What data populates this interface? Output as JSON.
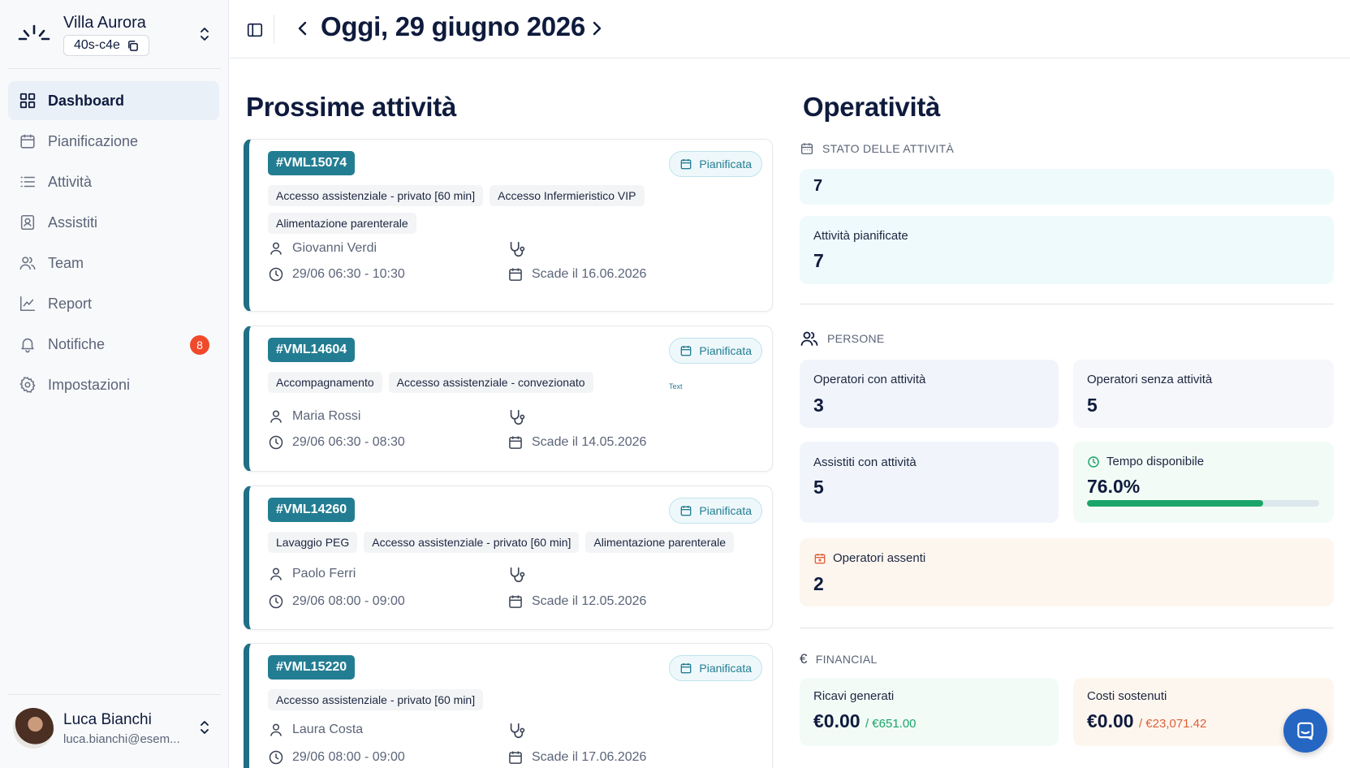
{
  "org": {
    "name": "Villa Aurora",
    "code": "40s-c4e"
  },
  "nav": {
    "items": [
      {
        "label": "Dashboard",
        "icon": "grid-icon",
        "active": true
      },
      {
        "label": "Pianificazione",
        "icon": "calendar-icon"
      },
      {
        "label": "Attività",
        "icon": "list-icon"
      },
      {
        "label": "Assistiti",
        "icon": "contact-icon"
      },
      {
        "label": "Team",
        "icon": "users-icon"
      },
      {
        "label": "Report",
        "icon": "chart-icon"
      },
      {
        "label": "Notifiche",
        "icon": "bell-icon",
        "badge": "8"
      },
      {
        "label": "Impostazioni",
        "icon": "gear-icon"
      }
    ]
  },
  "user": {
    "name": "Luca Bianchi",
    "email": "luca.bianchi@esem..."
  },
  "header": {
    "title": "Oggi, 29 giugno 2026"
  },
  "activities": {
    "title": "Prossime attività",
    "cards": [
      {
        "code": "#VML15074",
        "status": "Pianificata",
        "tags": [
          "Accesso assistenziale - privato [60 min]",
          "Accesso Infermieristico VIP",
          "Alimentazione parenterale"
        ],
        "person": "Giovanni Verdi",
        "time": "29/06 06:30 - 10:30",
        "due": "Scade il 16.06.2026"
      },
      {
        "code": "#VML14604",
        "status": "Pianificata",
        "tags": [
          "Accompagnamento",
          "Accesso assistenziale - convezionato"
        ],
        "extra": "Text",
        "person": "Maria Rossi",
        "time": "29/06 06:30 - 08:30",
        "due": "Scade il 14.05.2026"
      },
      {
        "code": "#VML14260",
        "status": "Pianificata",
        "tags": [
          "Lavaggio PEG",
          "Accesso assistenziale - privato [60 min]",
          "Alimentazione parenterale"
        ],
        "person": "Paolo Ferri",
        "time": "29/06 08:00 - 09:00",
        "due": "Scade il 12.05.2026"
      },
      {
        "code": "#VML15220",
        "status": "Pianificata",
        "tags": [
          "Accesso assistenziale - privato [60 min]"
        ],
        "person": "Laura Costa",
        "time": "29/06 08:00 - 09:00",
        "due": "Scade il 17.06.2026"
      }
    ]
  },
  "ops": {
    "title": "Operatività",
    "status": {
      "label": "STATO DELLE ATTIVITÀ",
      "total": "7",
      "planned_label": "Attività pianificate",
      "planned_value": "7"
    },
    "people": {
      "label": "PERSONE",
      "with_label": "Operatori con attività",
      "with_value": "3",
      "without_label": "Operatori senza attività",
      "without_value": "5",
      "assisted_label": "Assistiti con attività",
      "assisted_value": "5",
      "time_label": "Tempo disponibile",
      "time_value": "76.0%",
      "time_percent": 76,
      "absent_label": "Operatori assenti",
      "absent_value": "2"
    },
    "financial": {
      "label": "FINANCIAL",
      "revenue_label": "Ricavi generati",
      "revenue_value": "€0.00",
      "revenue_target": "/ €651.00",
      "cost_label": "Costi sostenuti",
      "cost_value": "€0.00",
      "cost_target": "/ €23,071.42"
    }
  },
  "colors": {
    "accent": "#237d92",
    "badge": "#ef4a2b",
    "progress": "#1aa56b",
    "chat": "#2566c2"
  }
}
